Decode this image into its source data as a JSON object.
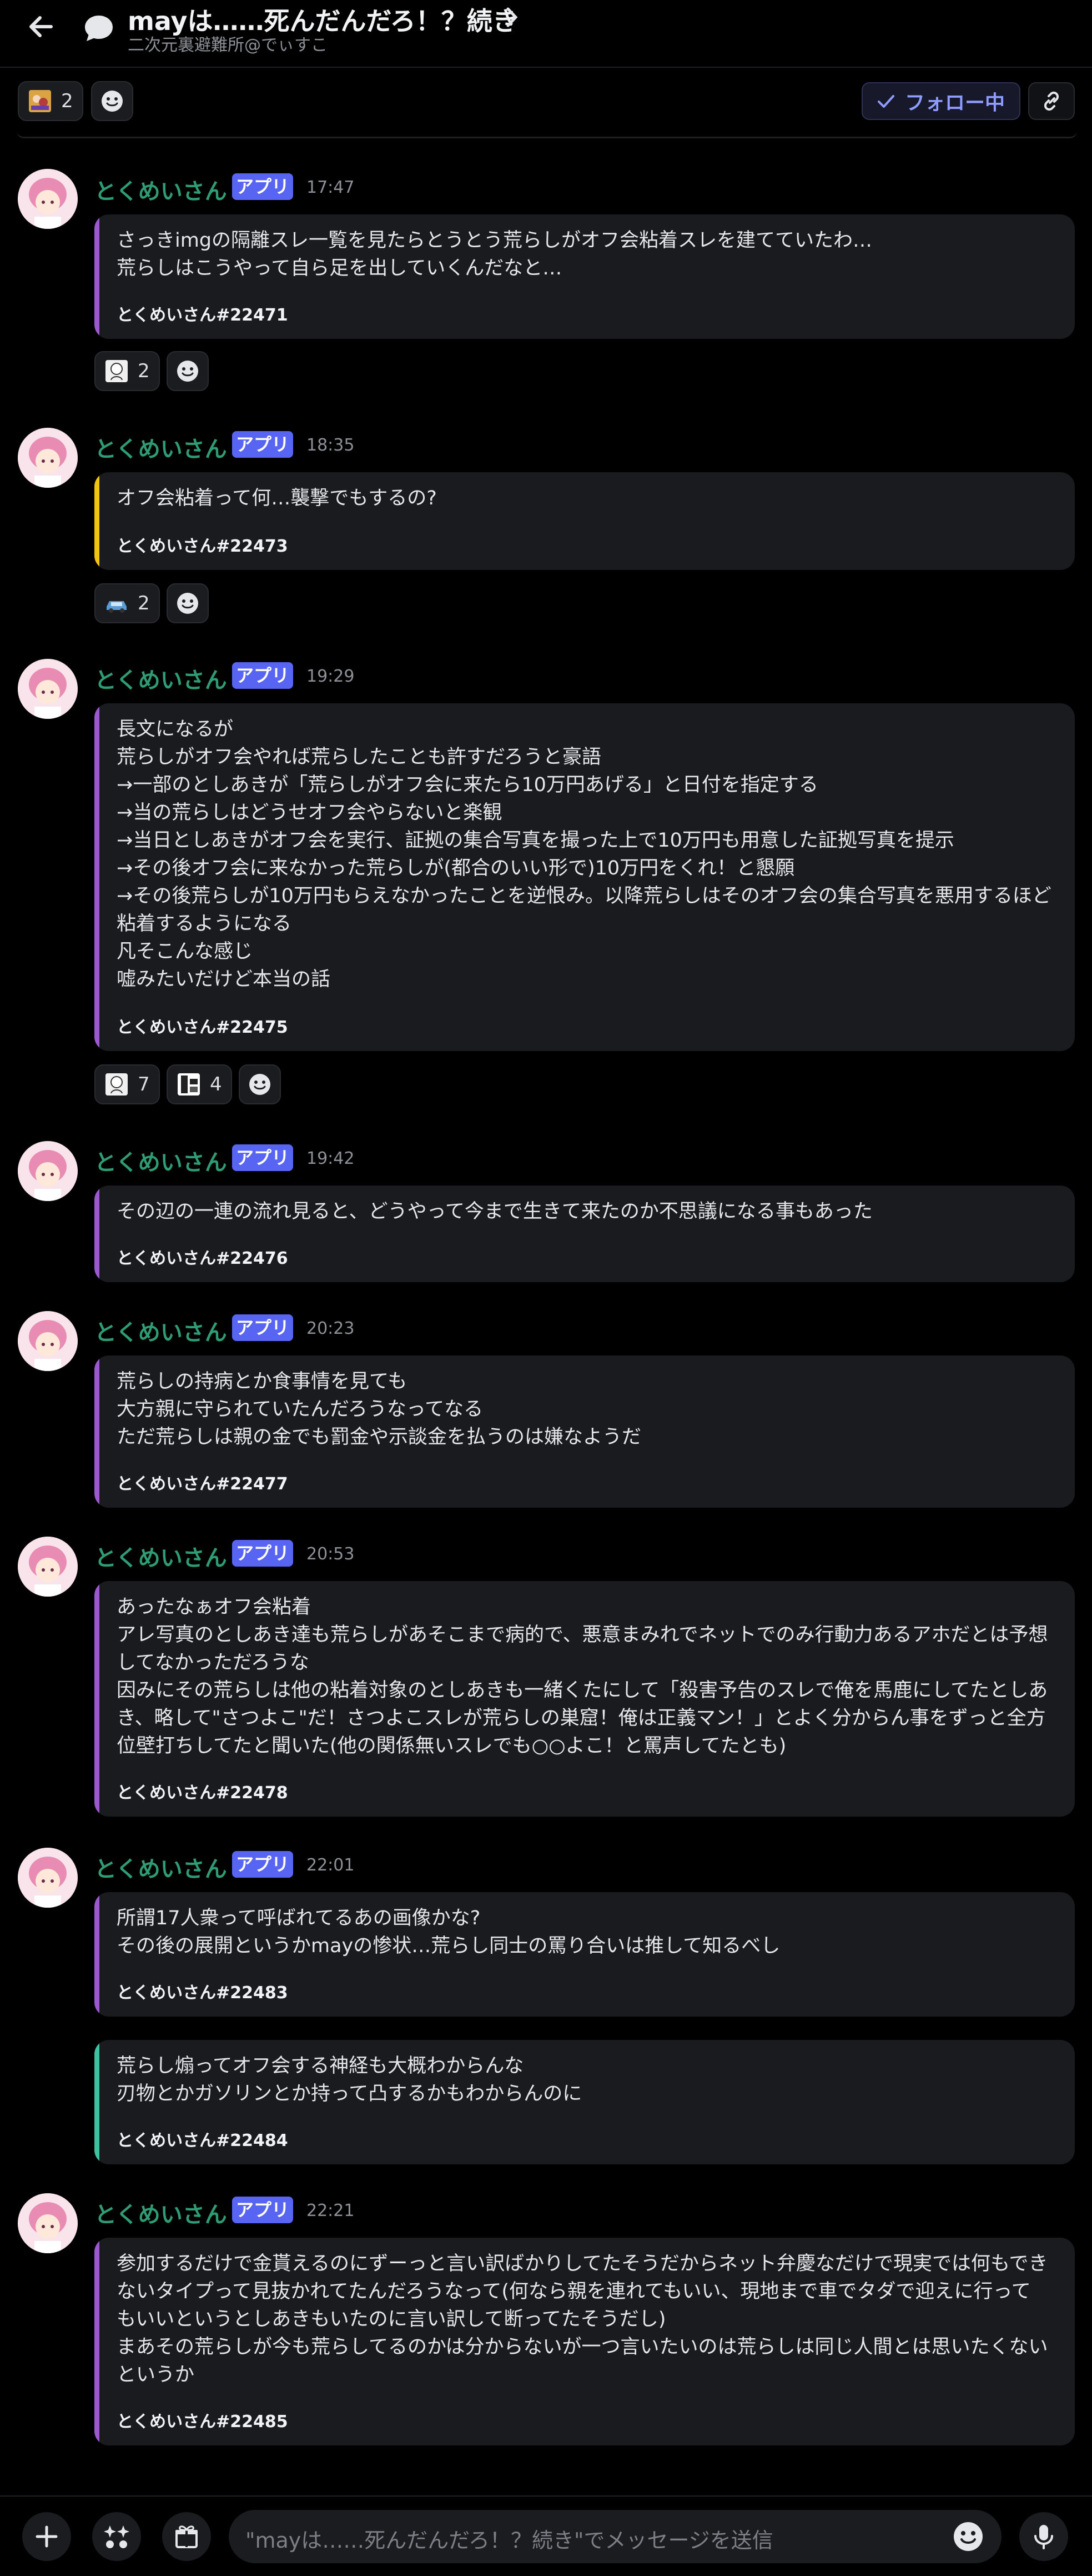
{
  "header": {
    "title": "mayは……死んだんだろ！？続き",
    "subtitle": "二次元裏避難所@でぃすこ"
  },
  "top_reactions": [
    {
      "count": "2"
    }
  ],
  "follow_label": "フォロー中",
  "badge_label": "アプリ",
  "messages": [
    {
      "author": "とくめいさん",
      "time": "17:47",
      "bar_color": "#9b59d0",
      "lines": [
        "さっきimgの隔離スレ一覧を見たらとうとう荒らしがオフ会粘着スレを建てていたわ…",
        "荒らしはこうやって自ら足を出していくんだなと…"
      ],
      "sig": "とくめいさん#22471",
      "reactions": [
        {
          "count": "2"
        }
      ]
    },
    {
      "author": "とくめいさん",
      "time": "18:35",
      "bar_color": "#f1c40f",
      "lines": [
        "オフ会粘着って何…襲撃でもするの?"
      ],
      "sig": "とくめいさん#22473",
      "reactions": [
        {
          "count": "2"
        }
      ]
    },
    {
      "author": "とくめいさん",
      "time": "19:29",
      "bar_color": "#9b59d0",
      "lines": [
        "長文になるが",
        "荒らしがオフ会やれば荒らしたことも許すだろうと豪語",
        "→一部のとしあきが「荒らしがオフ会に来たら10万円あげる」と日付を指定する",
        "→当の荒らしはどうせオフ会やらないと楽観",
        "→当日としあきがオフ会を実行、証拠の集合写真を撮った上で10万円も用意した証拠写真を提示",
        "→その後オフ会に来なかった荒らしが(都合のいい形で)10万円をくれ！と懇願",
        "→その後荒らしが10万円もらえなかったことを逆恨み。以降荒らしはそのオフ会の集合写真を悪用するほど",
        "粘着するようになる",
        "凡そこんな感じ",
        "嘘みたいだけど本当の話"
      ],
      "sig": "とくめいさん#22475",
      "reactions": [
        {
          "count": "7"
        },
        {
          "count": "4"
        }
      ]
    },
    {
      "author": "とくめいさん",
      "time": "19:42",
      "bar_color": "#9b59d0",
      "lines": [
        "その辺の一連の流れ見ると、どうやって今まで生きて来たのか不思議になる事もあった"
      ],
      "sig": "とくめいさん#22476"
    },
    {
      "author": "とくめいさん",
      "time": "20:23",
      "bar_color": "#9b59d0",
      "lines": [
        "荒らしの持病とか食事情を見ても",
        "大方親に守られていたんだろうなってなる",
        "ただ荒らしは親の金でも罰金や示談金を払うのは嫌なようだ"
      ],
      "sig": "とくめいさん#22477"
    },
    {
      "author": "とくめいさん",
      "time": "20:53",
      "bar_color": "#9b59d0",
      "lines": [
        "あったなぁオフ会粘着",
        "アレ写真のとしあき達も荒らしがあそこまで病的で、悪意まみれでネットでのみ行動力あるアホだとは予想",
        "してなかっただろうな",
        "因みにその荒らしは他の粘着対象のとしあきも一緒くたにして「殺害予告のスレで俺を馬鹿にしてたとしあ",
        "き、略して\"さつよこ\"だ！さつよこスレが荒らしの巣窟！俺は正義マン！」とよく分からん事をずっと全方",
        "位壁打ちしてたと聞いた(他の関係無いスレでも○○よこ！と罵声してたとも)"
      ],
      "sig": "とくめいさん#22478"
    },
    {
      "author": "とくめいさん",
      "time": "22:01",
      "bar_color": "#9b59d0",
      "lines": [
        "所謂17人衆って呼ばれてるあの画像かな?",
        "その後の展開というかmayの惨状…荒らし同士の罵り合いは推して知るべし"
      ],
      "sig": "とくめいさん#22483"
    },
    {
      "bar_color": "#3fc1a0",
      "lines": [
        "荒らし煽ってオフ会する神経も大概わからんな",
        "刃物とかガソリンとか持って凸するかもわからんのに"
      ],
      "sig": "とくめいさん#22484"
    },
    {
      "author": "とくめいさん",
      "time": "22:21",
      "bar_color": "#9b59d0",
      "lines": [
        "参加するだけで金貰えるのにずーっと言い訳ばかりしてたそうだからネット弁慶なだけで現実では何もでき",
        "ないタイプって見抜かれてたんだろうなって(何なら親を連れてもいい、現地まで車でタダで迎えに行って",
        "もいいというとしあきもいたのに言い訳して断ってたそうだし)",
        "まあその荒らしが今も荒らしてるのかは分からないが一つ言いたいのは荒らしは同じ人間とは思いたくない",
        "というか"
      ],
      "sig": "とくめいさん#22485"
    }
  ],
  "composer": {
    "placeholder": "\"mayは……死んだんだろ！？続き\"でメッセージを送信"
  },
  "icons": {
    "back": "arrow-left-icon",
    "channel": "speech-bubble-icon",
    "add_reaction": "smiley-icon",
    "follow": "check-icon",
    "link": "link-icon",
    "plus": "plus-icon",
    "apps": "apps-icon",
    "gift": "gift-icon",
    "emoji": "emoji-icon",
    "mic": "microphone-icon"
  },
  "colors": {
    "accent": "#5865f2",
    "author": "#2e9d76",
    "follow_text": "#8e9bff"
  }
}
